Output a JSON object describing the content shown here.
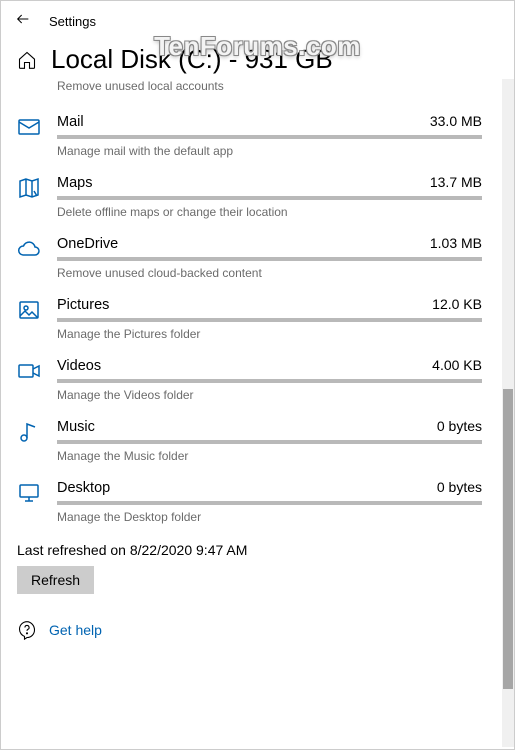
{
  "header": {
    "title": "Settings"
  },
  "watermark": "TenForums.com",
  "page": {
    "title": "Local Disk (C:) - 931 GB"
  },
  "truncated_prev_desc": "Remove unused local accounts",
  "categories": [
    {
      "name": "Mail",
      "size": "33.0 MB",
      "desc": "Manage mail with the default app",
      "icon": "mail-icon"
    },
    {
      "name": "Maps",
      "size": "13.7 MB",
      "desc": "Delete offline maps or change their location",
      "icon": "maps-icon"
    },
    {
      "name": "OneDrive",
      "size": "1.03 MB",
      "desc": "Remove unused cloud-backed content",
      "icon": "cloud-icon"
    },
    {
      "name": "Pictures",
      "size": "12.0 KB",
      "desc": "Manage the Pictures folder",
      "icon": "pictures-icon"
    },
    {
      "name": "Videos",
      "size": "4.00 KB",
      "desc": "Manage the Videos folder",
      "icon": "videos-icon"
    },
    {
      "name": "Music",
      "size": "0 bytes",
      "desc": "Manage the Music folder",
      "icon": "music-icon"
    },
    {
      "name": "Desktop",
      "size": "0 bytes",
      "desc": "Manage the Desktop folder",
      "icon": "desktop-icon"
    }
  ],
  "footer": {
    "last_refreshed": "Last refreshed on 8/22/2020 9:47 AM",
    "refresh_label": "Refresh",
    "help_label": "Get help"
  },
  "colors": {
    "accent": "#0063B1"
  }
}
